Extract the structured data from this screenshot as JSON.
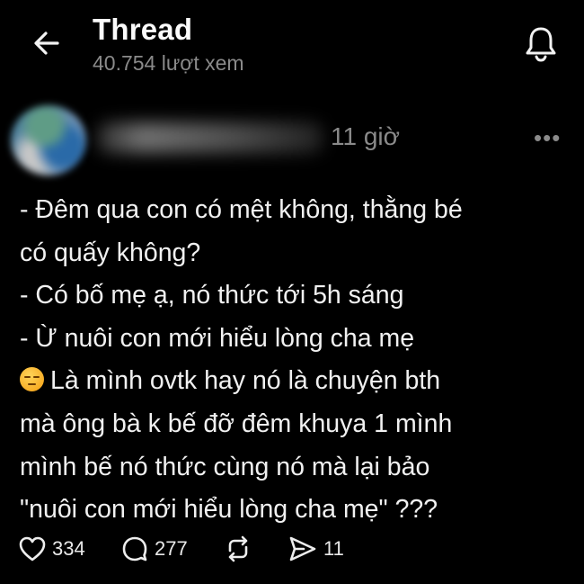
{
  "header": {
    "title": "Thread",
    "views": "40.754 lượt xem",
    "back_icon": "arrow-left-icon",
    "bell_icon": "bell-icon"
  },
  "post": {
    "author_name": "",
    "time": "11 giờ",
    "more_icon": "more-horizontal-icon",
    "lines": [
      "- Đêm qua con có mệt không, thằng bé",
      "có quấy không?",
      "- Có bố mẹ ạ, nó thức tới 5h sáng",
      "- Ừ nuôi con mới hiểu lòng cha mẹ",
      "Là mình ovtk hay nó là chuyện bth",
      "mà ông bà k bế đỡ đêm khuya 1 mình",
      "mình bế nó thức cùng nó mà lại bảo",
      "\"nuôi con mới hiểu lòng cha mẹ\" ???"
    ],
    "emoji": "relieved-face-emoji"
  },
  "actions": {
    "likes": "334",
    "comments": "277",
    "shares": "11",
    "icons": [
      "heart-icon",
      "comment-icon",
      "repost-icon",
      "send-icon"
    ]
  },
  "colors": {
    "background": "#000000",
    "text": "#f1f1f1",
    "muted": "#8a8a8a"
  }
}
